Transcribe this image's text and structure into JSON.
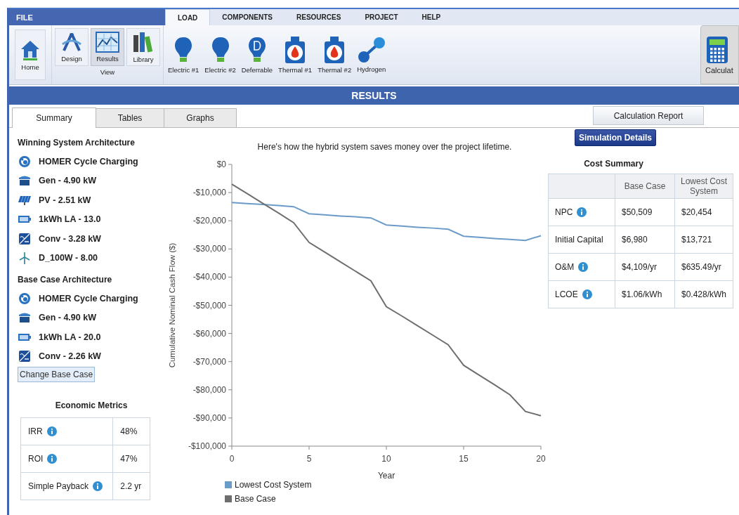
{
  "menu": {
    "file": "FILE",
    "tabs": [
      {
        "label": "LOAD",
        "selected": true
      },
      {
        "label": "COMPONENTS",
        "selected": false
      },
      {
        "label": "RESOURCES",
        "selected": false
      },
      {
        "label": "PROJECT",
        "selected": false
      },
      {
        "label": "HELP",
        "selected": false
      }
    ]
  },
  "ribbon": {
    "home": {
      "label": "Home",
      "kind": "home"
    },
    "view_group": {
      "label": "View",
      "buttons": [
        {
          "label": "Design",
          "kind": "design",
          "selected": false
        },
        {
          "label": "Results",
          "kind": "results",
          "selected": true
        },
        {
          "label": "Library",
          "kind": "library",
          "selected": false
        }
      ]
    },
    "load_buttons": [
      {
        "label": "Electric #1",
        "kind": "bulb"
      },
      {
        "label": "Electric #2",
        "kind": "bulb"
      },
      {
        "label": "Deferrable",
        "kind": "deferrable"
      },
      {
        "label": "Thermal #1",
        "kind": "thermal"
      },
      {
        "label": "Thermal #2",
        "kind": "thermal"
      },
      {
        "label": "Hydrogen",
        "kind": "hydrogen"
      }
    ],
    "calculate": {
      "label": "Calculat"
    }
  },
  "title_bar": "RESULTS",
  "result_tabs": [
    {
      "label": "Summary",
      "selected": true
    },
    {
      "label": "Tables",
      "selected": false
    },
    {
      "label": "Graphs",
      "selected": false
    }
  ],
  "calculation_report": "Calculation Report",
  "winning_architecture": {
    "title": "Winning System Architecture",
    "items": [
      {
        "kind": "controller",
        "label": "HOMER Cycle Charging"
      },
      {
        "kind": "generator",
        "label": "Gen - 4.90 kW"
      },
      {
        "kind": "pv",
        "label": "PV - 2.51 kW"
      },
      {
        "kind": "battery",
        "label": "1kWh LA - 13.0"
      },
      {
        "kind": "converter",
        "label": "Conv - 3.28 kW"
      },
      {
        "kind": "wind",
        "label": "D_100W - 8.00"
      }
    ]
  },
  "base_architecture": {
    "title": "Base Case Architecture",
    "items": [
      {
        "kind": "controller",
        "label": "HOMER Cycle Charging"
      },
      {
        "kind": "generator",
        "label": "Gen - 4.90 kW"
      },
      {
        "kind": "battery",
        "label": "1kWh LA - 20.0"
      },
      {
        "kind": "converter",
        "label": "Conv - 2.26 kW"
      }
    ]
  },
  "change_base_case": "Change Base Case",
  "economic_metrics": {
    "title": "Economic Metrics",
    "rows": [
      {
        "label": "IRR",
        "info": true,
        "value": "48%"
      },
      {
        "label": "ROI",
        "info": true,
        "value": "47%"
      },
      {
        "label": "Simple Payback",
        "info": true,
        "value": "2.2 yr"
      }
    ]
  },
  "chart_caption": "Here's how the hybrid system saves money over the project lifetime.",
  "chart_data": {
    "type": "line",
    "xlabel": "Year",
    "ylabel": "Cumulative Nominal Cash Flow ($)",
    "x": [
      0,
      1,
      2,
      3,
      4,
      5,
      6,
      7,
      8,
      9,
      10,
      11,
      12,
      13,
      14,
      15,
      16,
      17,
      18,
      19,
      20
    ],
    "series": [
      {
        "name": "Lowest Cost System",
        "color": "#6b9bc9",
        "values": [
          -13500,
          -13900,
          -14200,
          -14600,
          -15000,
          -17500,
          -17900,
          -18300,
          -18600,
          -19000,
          -21500,
          -21900,
          -22300,
          -22600,
          -23000,
          -25500,
          -25900,
          -26300,
          -26600,
          -27000,
          -25300
        ]
      },
      {
        "name": "Base Case",
        "color": "#6e6e6e",
        "values": [
          -7000,
          -10400,
          -13800,
          -17200,
          -20700,
          -27700,
          -31100,
          -34500,
          -37900,
          -41300,
          -50500,
          -53800,
          -57200,
          -60600,
          -64000,
          -71300,
          -74800,
          -78200,
          -81800,
          -87700,
          -89200
        ]
      }
    ],
    "xlim": [
      0,
      20
    ],
    "ylim": [
      -100000,
      0
    ],
    "xticks": [
      0,
      5,
      10,
      15,
      20
    ],
    "yticks": [
      {
        "value": 0,
        "label": "$0"
      },
      {
        "value": -10000,
        "label": "-$10,000"
      },
      {
        "value": -20000,
        "label": "-$20,000"
      },
      {
        "value": -30000,
        "label": "-$30,000"
      },
      {
        "value": -40000,
        "label": "-$40,000"
      },
      {
        "value": -50000,
        "label": "-$50,000"
      },
      {
        "value": -60000,
        "label": "-$60,000"
      },
      {
        "value": -70000,
        "label": "-$70,000"
      },
      {
        "value": -80000,
        "label": "-$80,000"
      },
      {
        "value": -90000,
        "label": "-$90,000"
      },
      {
        "value": -100000,
        "label": "-$100,000"
      }
    ]
  },
  "simulation_details": "Simulation Details",
  "cost_summary": {
    "title": "Cost Summary",
    "columns": [
      "Base Case",
      "Lowest Cost System"
    ],
    "rows": [
      {
        "label": "NPC",
        "info": true,
        "values": [
          "$50,509",
          "$20,454"
        ]
      },
      {
        "label": "Initial Capital",
        "info": false,
        "values": [
          "$6,980",
          "$13,721"
        ]
      },
      {
        "label": "O&M",
        "info": true,
        "values": [
          "$4,109/yr",
          "$635.49/yr"
        ]
      },
      {
        "label": "LCOE",
        "info": true,
        "values": [
          "$1.06/kWh",
          "$0.428/kWh"
        ]
      }
    ]
  }
}
